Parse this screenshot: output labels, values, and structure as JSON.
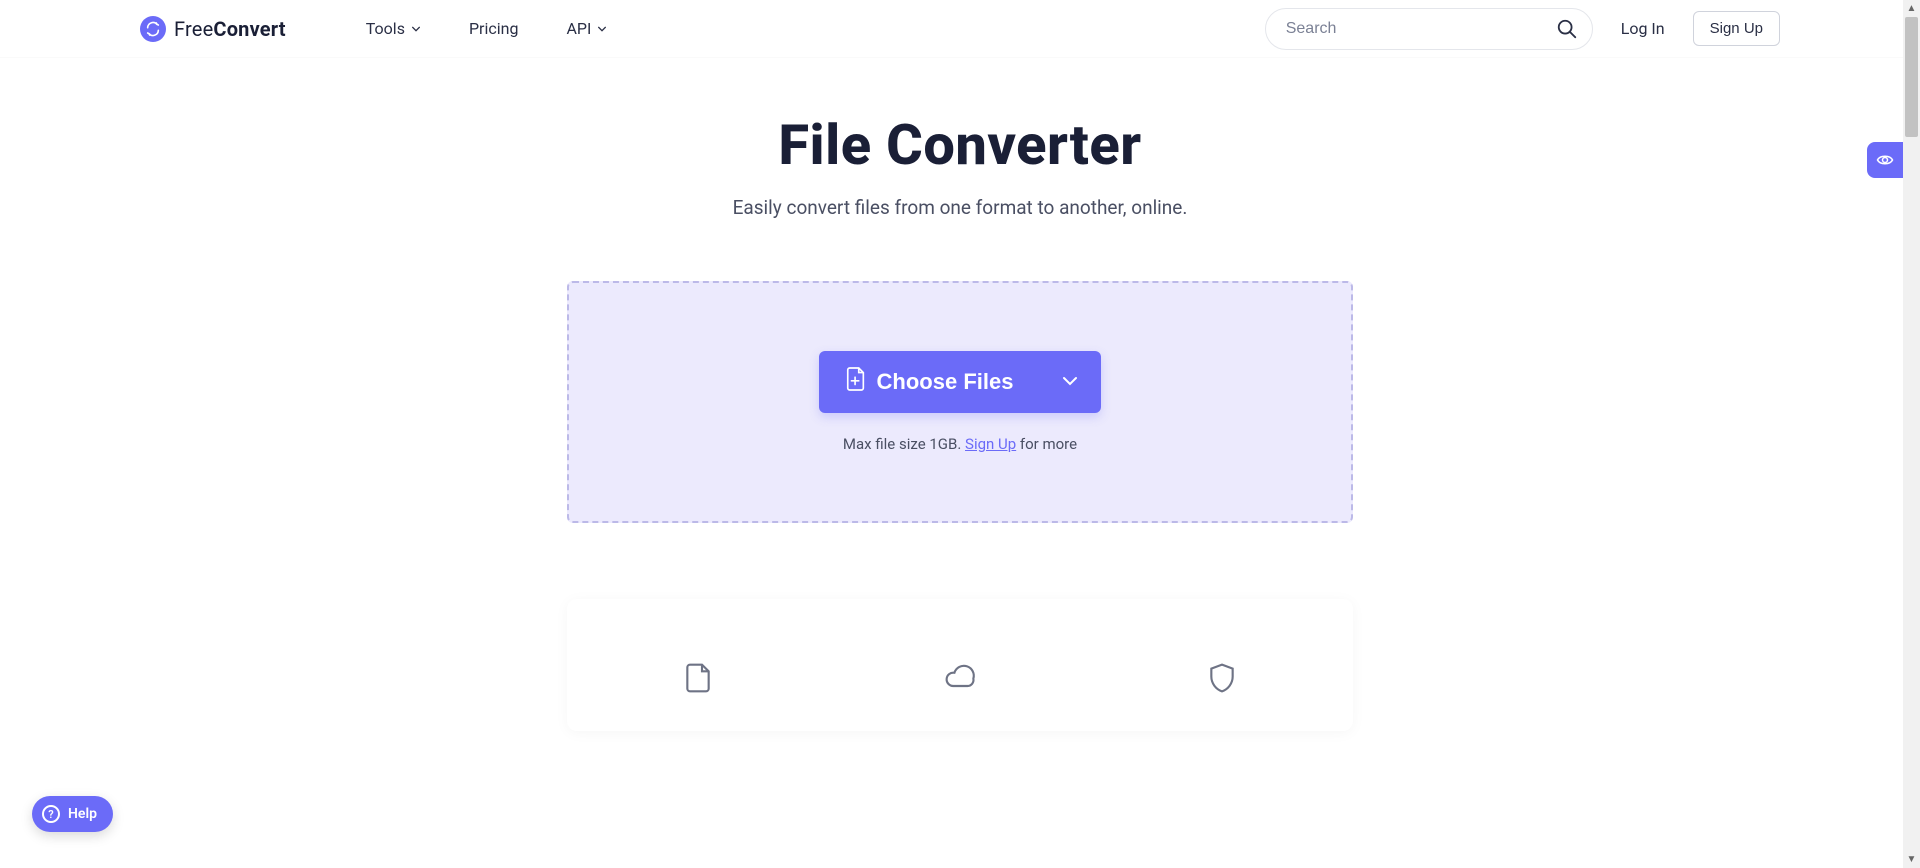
{
  "brand": {
    "light": "Free",
    "bold": "Convert"
  },
  "nav": {
    "tools": "Tools",
    "pricing": "Pricing",
    "api": "API"
  },
  "search": {
    "placeholder": "Search"
  },
  "auth": {
    "login": "Log In",
    "signup": "Sign Up"
  },
  "hero": {
    "title": "File Converter",
    "subtitle": "Easily convert files from one format to another, online."
  },
  "upload": {
    "button": "Choose Files",
    "note_prefix": "Max file size 1GB. ",
    "note_link": "Sign Up",
    "note_suffix": " for more"
  },
  "help": {
    "label": "Help"
  },
  "colors": {
    "accent": "#6b6bf8"
  }
}
